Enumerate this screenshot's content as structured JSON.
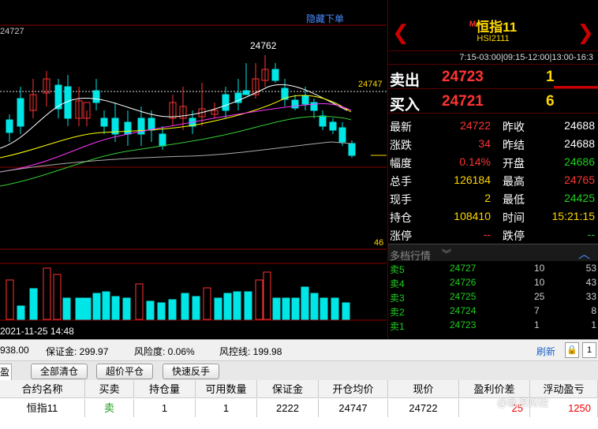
{
  "chart": {
    "hide_orders_label": "隐藏下单",
    "axis_top_label": "24727",
    "peak_label": "24762",
    "right_price_label": "24747",
    "bottom_right_label": "46",
    "date_label": "2021-11-25 14:48",
    "colors": {
      "up": "#ff3333",
      "down": "#00e5e5",
      "ma_white": "#ffffff",
      "ma_yellow": "#ffff00",
      "ma_magenta": "#ff33ff",
      "ma_green": "#33cc33",
      "grid": "#8b0000"
    }
  },
  "quote": {
    "name": "恒指11",
    "name_tag": "M",
    "code": "HSI2111",
    "hours": "7:15-03:00|09:15-12:00|13:00-16:3",
    "sell_label": "卖出",
    "sell_price": "24723",
    "sell_volume": "1",
    "buy_label": "买入",
    "buy_price": "24721",
    "buy_volume": "6",
    "stats": [
      {
        "k1": "最新",
        "v1": "24722",
        "c1": "#ff3333",
        "k2": "昨收",
        "v2": "24688",
        "c2": "#ffffff"
      },
      {
        "k1": "涨跌",
        "v1": "34",
        "c1": "#ff3333",
        "k2": "昨结",
        "v2": "24688",
        "c2": "#ffffff"
      },
      {
        "k1": "幅度",
        "v1": "0.14%",
        "c1": "#ff3333",
        "k2": "开盘",
        "v2": "24686",
        "c2": "#1fcf1f"
      },
      {
        "k1": "总手",
        "v1": "126184",
        "c1": "#ffd700",
        "k2": "最高",
        "v2": "24765",
        "c2": "#ff3333"
      },
      {
        "k1": "现手",
        "v1": "2",
        "c1": "#ffd700",
        "k2": "最低",
        "v2": "24425",
        "c2": "#1fcf1f"
      },
      {
        "k1": "持仓",
        "v1": "108410",
        "c1": "#ffd700",
        "k2": "时间",
        "v2": "15:21:15",
        "c2": "#ffd700"
      },
      {
        "k1": "涨停",
        "v1": "--",
        "c1": "#ff3333",
        "k2": "跌停",
        "v2": "--",
        "c2": "#1fcf1f"
      }
    ],
    "depth_title": "多档行情",
    "depth_toggle": "︿",
    "depth": [
      {
        "k": "卖5",
        "p": "24727",
        "v": "10",
        "o": "53"
      },
      {
        "k": "卖4",
        "p": "24726",
        "v": "10",
        "o": "43"
      },
      {
        "k": "卖3",
        "p": "24725",
        "v": "25",
        "o": "33"
      },
      {
        "k": "卖2",
        "p": "24724",
        "v": "7",
        "o": "8"
      },
      {
        "k": "卖1",
        "p": "24723",
        "v": "1",
        "o": "1"
      }
    ]
  },
  "account": {
    "balance": "938.00",
    "margin": "保证金: 299.97",
    "risk": "风险度: 0.06%",
    "risk_line": "风控线: 199.98",
    "refresh": "刷新",
    "scroll_btn": "1"
  },
  "actions": {
    "tab": "盈",
    "close_all": "全部清仓",
    "over_close": "超价平仓",
    "reverse": "快速反手"
  },
  "positions": {
    "headers": [
      "合约名称",
      "买卖",
      "持仓量",
      "可用数量",
      "保证金",
      "开仓均价",
      "现价",
      "盈利价差",
      "浮动盈亏"
    ],
    "row": [
      "恒指11",
      "卖",
      "1",
      "1",
      "2222",
      "24747",
      "24722",
      "25",
      "1250"
    ]
  },
  "watermark": "@新浪财经"
}
